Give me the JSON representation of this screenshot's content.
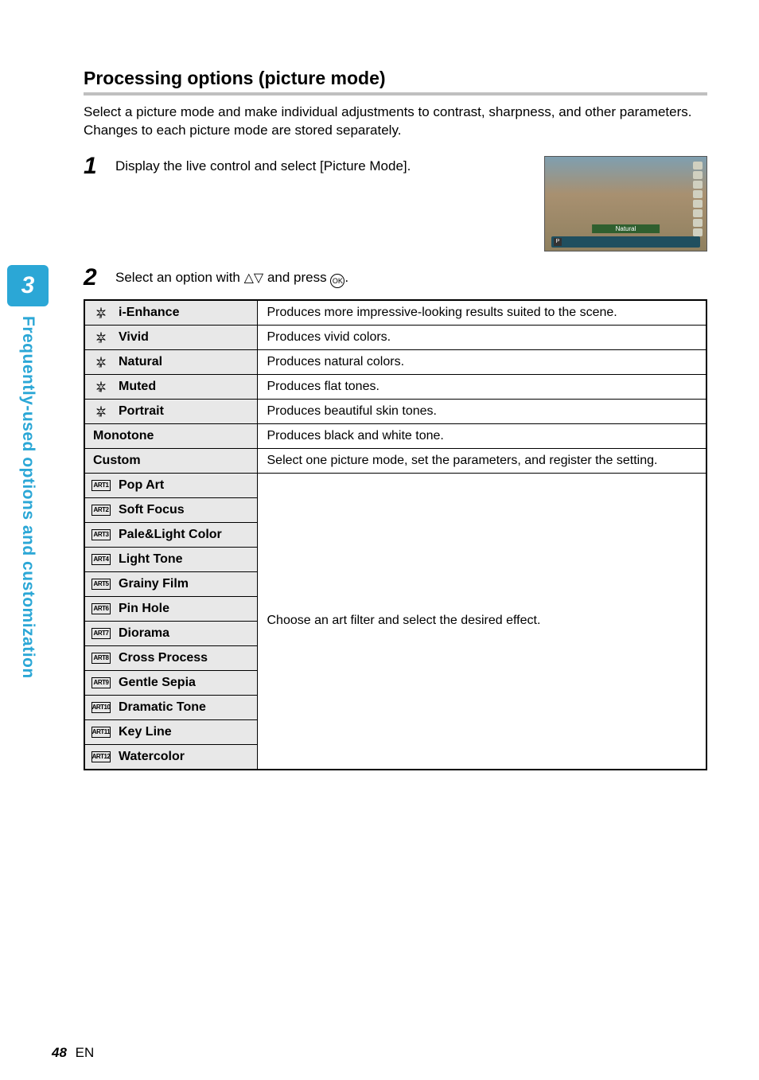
{
  "side": {
    "chapter": "3",
    "title": "Frequently-used options and customization"
  },
  "heading": "Processing options (picture mode)",
  "intro": "Select a picture mode and make individual adjustments to contrast, sharpness, and other parameters. Changes to each picture mode are stored separately.",
  "steps": [
    {
      "num": "1",
      "text": "Display the live control and select [Picture Mode]."
    },
    {
      "num": "2",
      "text_before": "Select an option with ",
      "text_mid": " and press ",
      "ok": "OK",
      "text_after": "."
    }
  ],
  "thumbnail": {
    "label": "Natural",
    "mode_letter": "P"
  },
  "table": [
    {
      "name": "i-Enhance",
      "desc": "Produces more impressive-looking results suited to the scene."
    },
    {
      "name": "Vivid",
      "desc": "Produces vivid colors."
    },
    {
      "name": "Natural",
      "desc": "Produces natural colors."
    },
    {
      "name": "Muted",
      "desc": "Produces flat tones."
    },
    {
      "name": "Portrait",
      "desc": "Produces beautiful skin tones."
    },
    {
      "name": "Monotone",
      "desc": "Produces black and white tone."
    },
    {
      "name": "Custom",
      "desc": "Select one picture mode, set the parameters, and register the setting."
    },
    {
      "name": "Pop Art"
    },
    {
      "name": "Soft Focus"
    },
    {
      "name": "Pale&Light Color"
    },
    {
      "name": "Light Tone"
    },
    {
      "name": "Grainy Film"
    },
    {
      "name": "Pin Hole"
    },
    {
      "name": "Diorama"
    },
    {
      "name": "Cross Process"
    },
    {
      "name": "Gentle Sepia"
    },
    {
      "name": "Dramatic Tone"
    },
    {
      "name": "Key Line"
    },
    {
      "name": "Watercolor"
    }
  ],
  "art": [
    "ART1",
    "ART2",
    "ART3",
    "ART4",
    "ART5",
    "ART6",
    "ART7",
    "ART8",
    "ART9",
    "ART10",
    "ART11",
    "ART12"
  ],
  "art_desc": "Choose an art filter and select the desired effect.",
  "footer": {
    "page": "48",
    "lang": "EN"
  }
}
